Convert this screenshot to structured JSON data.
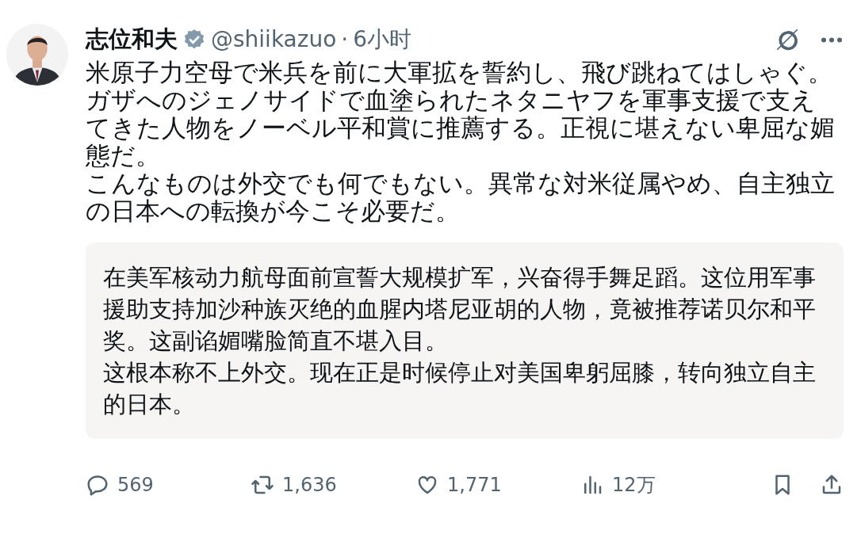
{
  "author": {
    "name": "志位和夫",
    "verified": true,
    "handle": "@shiikazuo",
    "separator": "·",
    "time": "6小时"
  },
  "body": [
    "米原子力空母で米兵を前に大軍拡を誓約し、飛び跳ねてはしゃぐ。",
    "ガザへのジェノサイドで血塗られたネタニヤフを軍事支援で支えてきた人物をノーベル平和賞に推薦する。正視に堪えない卑屈な媚態だ。",
    "こんなものは外交でも何でもない。異常な対米従属やめ、自主独立の日本への転換が今こそ必要だ。"
  ],
  "translation": [
    "在美军核动力航母面前宣誓大规模扩军，兴奋得手舞足蹈。这位用军事援助支持加沙种族灭绝的血腥内塔尼亚胡的人物，竟被推荐诺贝尔和平奖。这副谄媚嘴脸简直不堪入目。",
    "这根本称不上外交。现在正是时候停止对美国卑躬屈膝，转向独立自主的日本。"
  ],
  "actions": [
    {
      "kind": "reply",
      "count": "569"
    },
    {
      "kind": "repost",
      "count": "1,636"
    },
    {
      "kind": "like",
      "count": "1,771"
    },
    {
      "kind": "views",
      "count": "12万"
    },
    {
      "kind": "bookmark"
    },
    {
      "kind": "share"
    }
  ]
}
